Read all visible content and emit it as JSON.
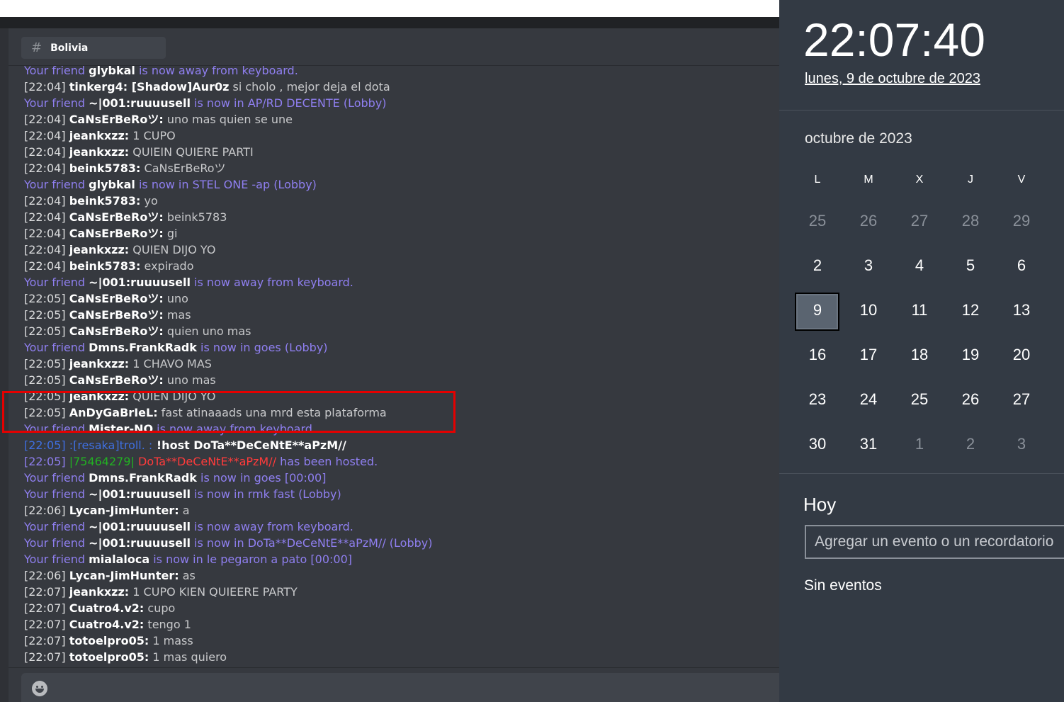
{
  "channel": {
    "name": "Bolivia"
  },
  "messages": [
    {
      "type": "sys",
      "pre": "Your friend ",
      "name": "glybkal",
      "post": " is now away from keyboard."
    },
    {
      "type": "chat",
      "ts": "[22:04] ",
      "user": "tinkerg4:",
      "text": " [Shadow]Aur0z",
      "text2": " si cholo , mejor deja el dota"
    },
    {
      "type": "sys",
      "pre": "Your friend ",
      "name": "~|001:ruuuusell",
      "post": " is now in AP/RD DECENTE (Lobby)"
    },
    {
      "type": "chat",
      "ts": "[22:04] ",
      "user": "CaNsErBeRoツ:",
      "text": " uno mas quien se une"
    },
    {
      "type": "chat",
      "ts": "[22:04] ",
      "user": "jeankxzz:",
      "text": " 1 CUPO"
    },
    {
      "type": "chat",
      "ts": "[22:04] ",
      "user": "jeankxzz:",
      "text": " QUIEIN QUIERE PARTI"
    },
    {
      "type": "chat",
      "ts": "[22:04] ",
      "user": "beink5783:",
      "text": " CaNsErBeRoツ"
    },
    {
      "type": "sys",
      "pre": "Your friend ",
      "name": "glybkal",
      "post": " is now in STEL ONE -ap (Lobby)"
    },
    {
      "type": "chat",
      "ts": "[22:04] ",
      "user": "beink5783:",
      "text": " yo"
    },
    {
      "type": "chat",
      "ts": "[22:04] ",
      "user": "CaNsErBeRoツ:",
      "text": " beink5783"
    },
    {
      "type": "chat",
      "ts": "[22:04] ",
      "user": "CaNsErBeRoツ:",
      "text": " gi"
    },
    {
      "type": "chat",
      "ts": "[22:04] ",
      "user": "jeankxzz:",
      "text": " QUIEN DIJO YO"
    },
    {
      "type": "chat",
      "ts": "[22:04] ",
      "user": "beink5783:",
      "text": " expirado"
    },
    {
      "type": "sys",
      "pre": "Your friend ",
      "name": "~|001:ruuuusell",
      "post": " is now away from keyboard."
    },
    {
      "type": "chat",
      "ts": "[22:05] ",
      "user": "CaNsErBeRoツ:",
      "text": " uno"
    },
    {
      "type": "chat",
      "ts": "[22:05] ",
      "user": "CaNsErBeRoツ:",
      "text": " mas"
    },
    {
      "type": "chat",
      "ts": "[22:05] ",
      "user": "CaNsErBeRoツ:",
      "text": " quien uno mas"
    },
    {
      "type": "sys",
      "pre": "Your friend ",
      "name": "Dmns.FrankRadk",
      "post": " is now in goes (Lobby)"
    },
    {
      "type": "chat",
      "ts": "[22:05] ",
      "user": "jeankxzz:",
      "text": " 1 CHAVO MAS"
    },
    {
      "type": "chat",
      "ts": "[22:05] ",
      "user": "CaNsErBeRoツ:",
      "text": " uno mas"
    },
    {
      "type": "chat",
      "ts": "[22:05] ",
      "user": "jeankxzz:",
      "text": " QUIEN DIJO YO"
    },
    {
      "type": "chat",
      "ts": "[22:05] ",
      "user": "AnDyGaBrIeL:",
      "text": " fast atinaaads una mrd esta plataforma"
    },
    {
      "type": "sys",
      "pre": "Your friend ",
      "name": "Mister-NO",
      "post": " is now away from keyboard."
    },
    {
      "type": "bot",
      "ts": "[22:05] ",
      "user": ":[resaka]troll. :",
      "text": " !host DoTa**DeCeNtE**aPzM//"
    },
    {
      "type": "host",
      "ts": "[22:05] ",
      "id": "|75464279|",
      "game": " DoTa**DeCeNtE**aPzM//",
      "post": " has been hosted."
    },
    {
      "type": "sys",
      "pre": "Your friend ",
      "name": "Dmns.FrankRadk",
      "post": " is now in goes [00:00]"
    },
    {
      "type": "sys",
      "pre": "Your friend ",
      "name": "~|001:ruuuusell",
      "post": " is now in rmk fast (Lobby)"
    },
    {
      "type": "chat",
      "ts": "[22:06] ",
      "user": "Lycan-JimHunter:",
      "text": " a"
    },
    {
      "type": "sys",
      "pre": "Your friend ",
      "name": "~|001:ruuuusell",
      "post": " is now away from keyboard."
    },
    {
      "type": "sys",
      "pre": "Your friend ",
      "name": "~|001:ruuuusell",
      "post": " is now in DoTa**DeCeNtE**aPzM// (Lobby)"
    },
    {
      "type": "sys",
      "pre": "Your friend ",
      "name": "mialaloca",
      "post": " is now in le pegaron a pato [00:00]"
    },
    {
      "type": "chat",
      "ts": "[22:06] ",
      "user": "Lycan-JimHunter:",
      "text": " as"
    },
    {
      "type": "chat",
      "ts": "[22:07] ",
      "user": "jeankxzz:",
      "text": " 1 CUPO KIEN QUIEERE PARTY"
    },
    {
      "type": "chat",
      "ts": "[22:07] ",
      "user": "Cuatro4.v2:",
      "text": " cupo"
    },
    {
      "type": "chat",
      "ts": "[22:07] ",
      "user": "Cuatro4.v2:",
      "text": " tengo 1"
    },
    {
      "type": "chat",
      "ts": "[22:07] ",
      "user": "totoelpro05:",
      "text": " 1 mass"
    },
    {
      "type": "chat",
      "ts": "[22:07] ",
      "user": "totoelpro05:",
      "text": " 1 mas quiero"
    }
  ],
  "clock": {
    "time": "22:07:40",
    "date": "lunes, 9 de octubre de 2023",
    "month_label": "octubre de 2023",
    "weekdays": [
      "L",
      "M",
      "X",
      "J",
      "V"
    ],
    "weeks": [
      [
        {
          "d": "25",
          "o": true
        },
        {
          "d": "26",
          "o": true
        },
        {
          "d": "27",
          "o": true
        },
        {
          "d": "28",
          "o": true
        },
        {
          "d": "29",
          "o": true
        }
      ],
      [
        {
          "d": "2"
        },
        {
          "d": "3"
        },
        {
          "d": "4"
        },
        {
          "d": "5"
        },
        {
          "d": "6"
        }
      ],
      [
        {
          "d": "9"
        },
        {
          "d": "10"
        },
        {
          "d": "11"
        },
        {
          "d": "12"
        },
        {
          "d": "13"
        }
      ],
      [
        {
          "d": "16"
        },
        {
          "d": "17"
        },
        {
          "d": "18"
        },
        {
          "d": "19"
        },
        {
          "d": "20"
        }
      ],
      [
        {
          "d": "23"
        },
        {
          "d": "24"
        },
        {
          "d": "25"
        },
        {
          "d": "26"
        },
        {
          "d": "27"
        }
      ],
      [
        {
          "d": "30"
        },
        {
          "d": "31"
        },
        {
          "d": "1",
          "o": true
        },
        {
          "d": "2",
          "o": true
        },
        {
          "d": "3",
          "o": true
        }
      ]
    ],
    "today_label": "Hoy",
    "event_placeholder": "Agregar un evento o un recordatorio",
    "no_events": "Sin eventos"
  }
}
